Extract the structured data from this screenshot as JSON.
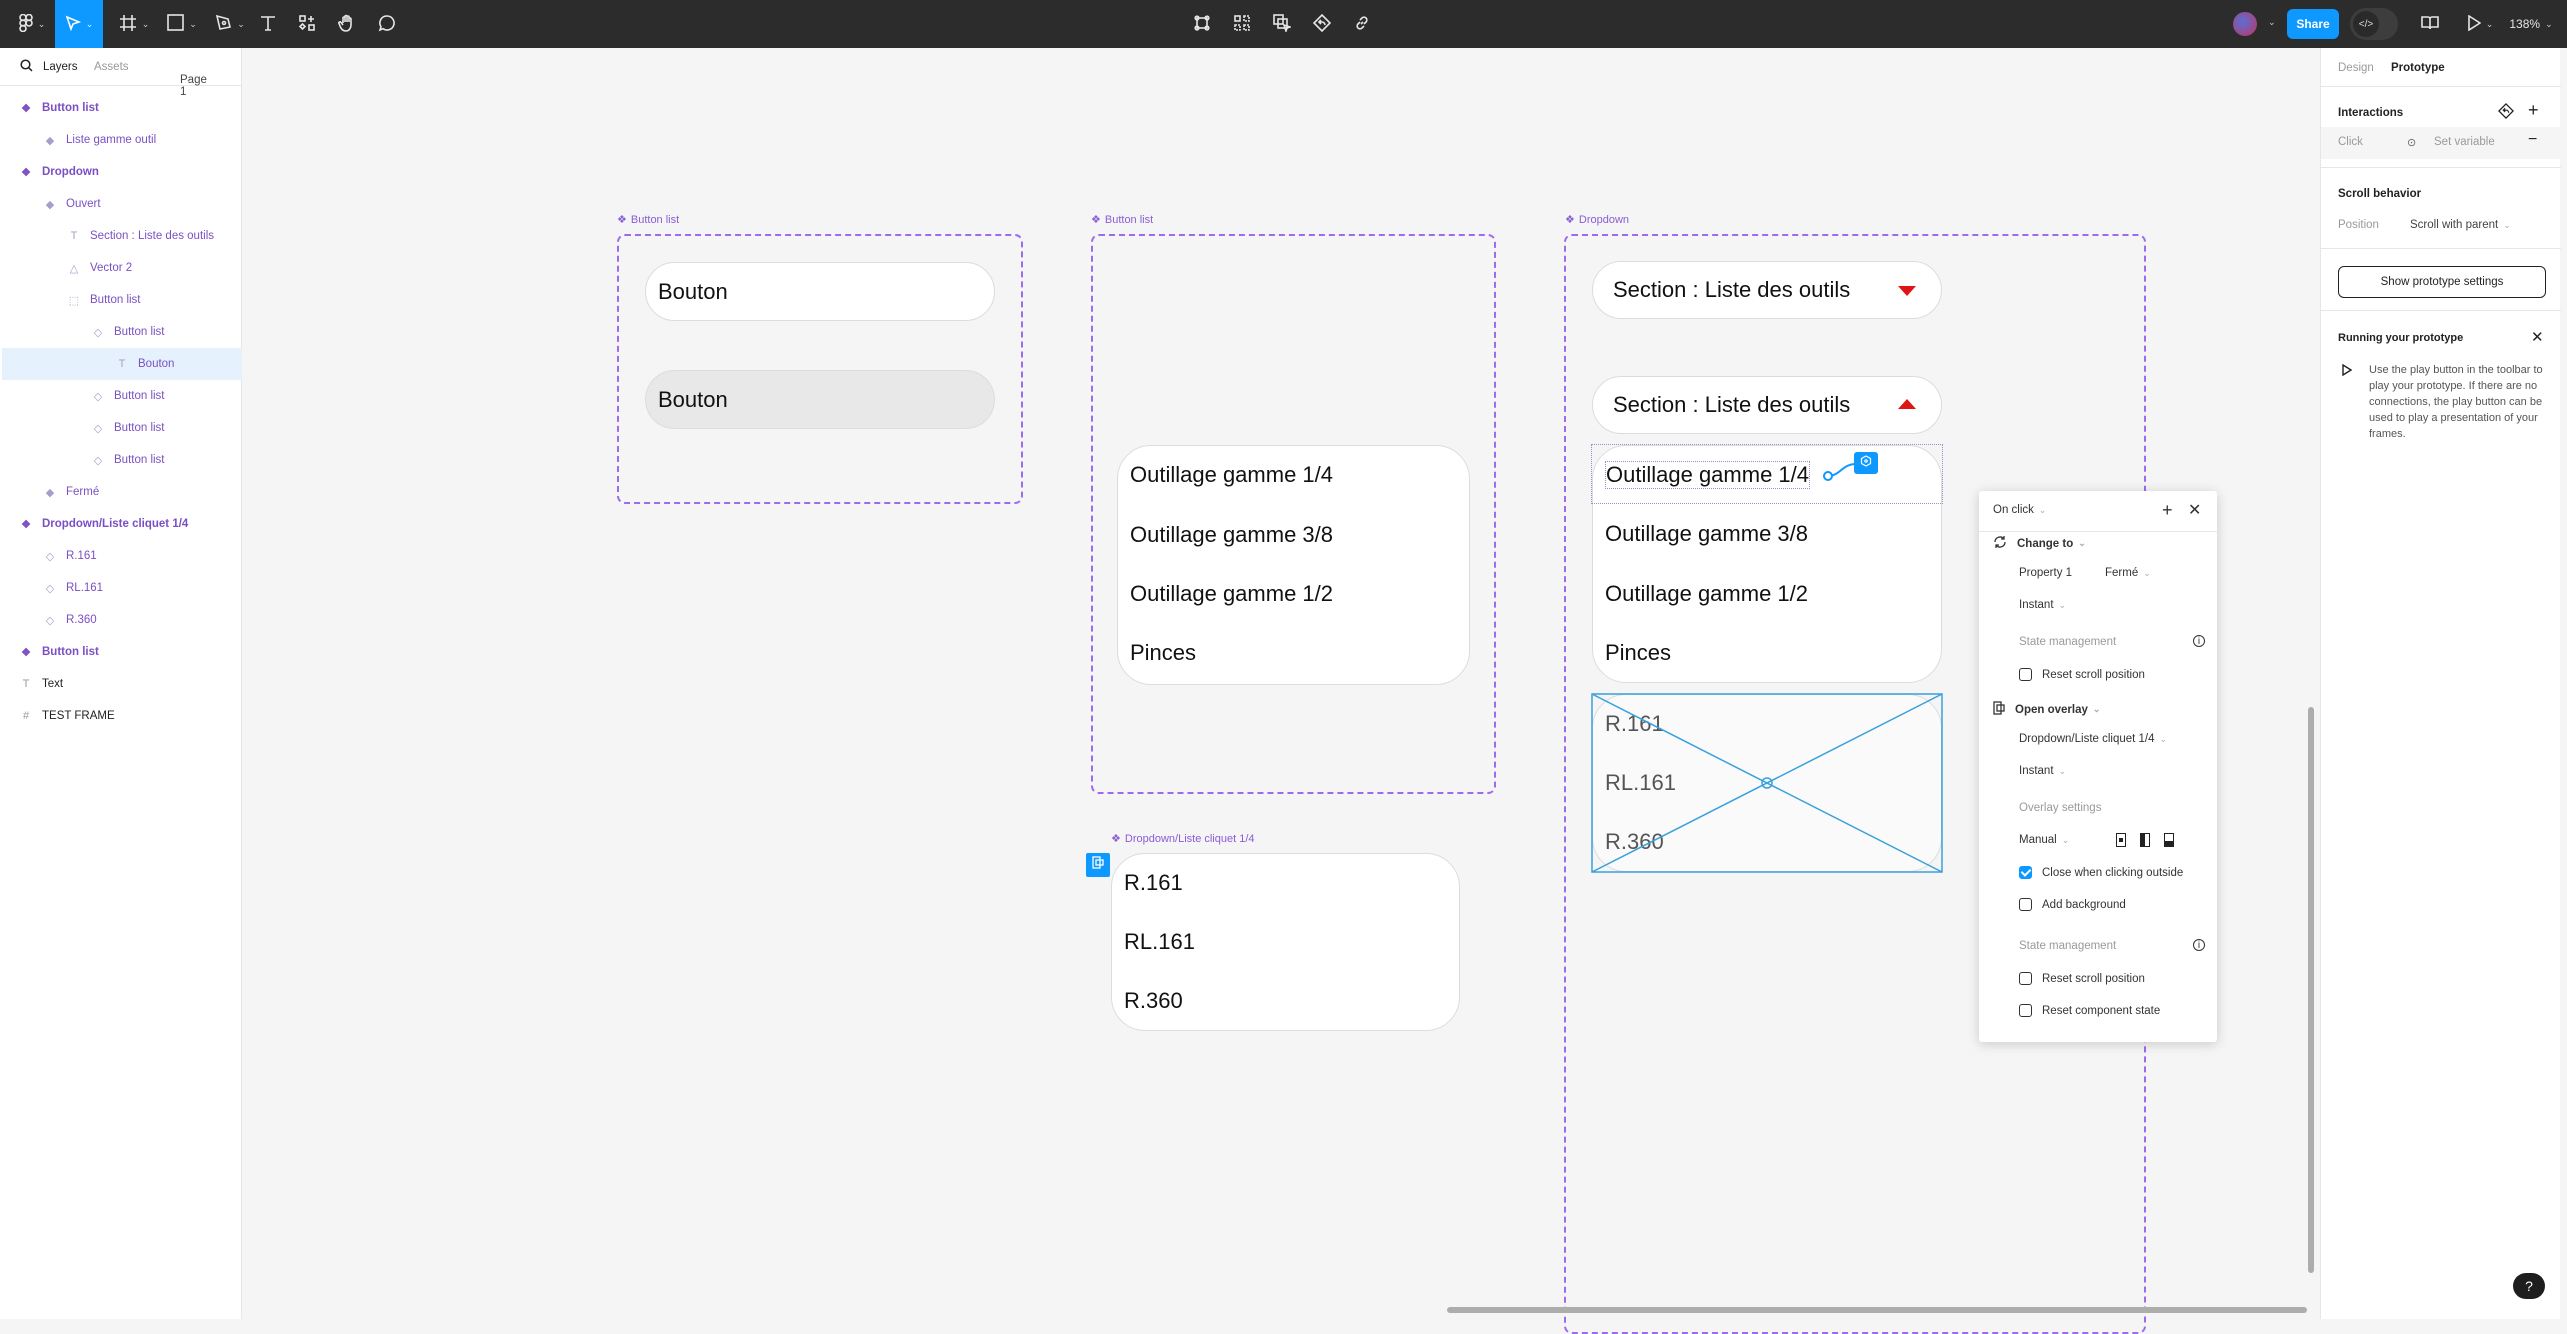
{
  "toolbar": {
    "tools": [
      {
        "name": "main-menu",
        "icon": "figma-logo-icon"
      },
      {
        "name": "move",
        "icon": "cursor-arrow-icon",
        "active": true
      },
      {
        "name": "frame",
        "icon": "frame-hash-icon"
      },
      {
        "name": "shape",
        "icon": "rectangle-icon"
      },
      {
        "name": "pen",
        "icon": "pen-icon"
      },
      {
        "name": "text",
        "icon": "text-icon"
      },
      {
        "name": "resources",
        "icon": "resources-icon"
      },
      {
        "name": "hand",
        "icon": "hand-icon"
      },
      {
        "name": "comment",
        "icon": "comment-icon"
      }
    ],
    "center_tools": [
      "component-edit-icon",
      "grid-icon",
      "overlay-select-icon",
      "reset-icon",
      "link-icon"
    ],
    "share_label": "Share",
    "dev_mode_icon": "</>",
    "zoom_label": "138%",
    "accent_color": "#0d99ff"
  },
  "left_panel": {
    "tabs": {
      "layers": "Layers",
      "assets": "Assets",
      "page": "Page 1"
    },
    "layers": [
      {
        "label": "Button list",
        "type": "component-set",
        "indent": 0
      },
      {
        "label": "Liste gamme outil",
        "type": "variant",
        "indent": 1
      },
      {
        "label": "Dropdown",
        "type": "component-set",
        "indent": 0
      },
      {
        "label": "Ouvert",
        "type": "variant",
        "indent": 1
      },
      {
        "label": "Section : Liste des outils",
        "type": "text",
        "indent": 2
      },
      {
        "label": "Vector 2",
        "type": "vector",
        "indent": 2
      },
      {
        "label": "Button list",
        "type": "instance-frame",
        "indent": 2
      },
      {
        "label": "Button list",
        "type": "instance",
        "indent": 3
      },
      {
        "label": "Bouton",
        "type": "text",
        "indent": 4,
        "selected": true
      },
      {
        "label": "Button list",
        "type": "instance",
        "indent": 3
      },
      {
        "label": "Button list",
        "type": "instance",
        "indent": 3
      },
      {
        "label": "Button list",
        "type": "instance",
        "indent": 3
      },
      {
        "label": "Fermé",
        "type": "variant",
        "indent": 1
      },
      {
        "label": "Dropdown/Liste cliquet 1/4",
        "type": "component-set",
        "indent": 0
      },
      {
        "label": "R.161",
        "type": "instance",
        "indent": 1
      },
      {
        "label": "RL.161",
        "type": "instance",
        "indent": 1
      },
      {
        "label": "R.360",
        "type": "instance",
        "indent": 1
      },
      {
        "label": "Button list",
        "type": "component-set",
        "indent": 0
      },
      {
        "label": "Text",
        "type": "text-plain",
        "indent": 0
      },
      {
        "label": "TEST FRAME",
        "type": "frame",
        "indent": 0
      }
    ]
  },
  "right_panel": {
    "tabs": {
      "design": "Design",
      "prototype": "Prototype"
    },
    "interactions_title": "Interactions",
    "interaction": {
      "trigger": "Click",
      "action": "Set variable"
    },
    "scroll_title": "Scroll behavior",
    "position_label": "Position",
    "position_value": "Scroll with parent",
    "show_settings_label": "Show prototype settings",
    "running_title": "Running your prototype",
    "running_text": "Use the play button in the toolbar to play your prototype. If there are no connections, the play button can be used to play a presentation of your frames."
  },
  "popover": {
    "trigger": "On click",
    "action1": {
      "label": "Change to",
      "property_label": "Property 1",
      "property_value": "Fermé",
      "animation": "Instant",
      "state_title": "State management",
      "reset_scroll": {
        "label": "Reset scroll position",
        "checked": false
      }
    },
    "action2": {
      "label": "Open overlay",
      "destination": "Dropdown/Liste cliquet 1/4",
      "animation": "Instant",
      "overlay_title": "Overlay settings",
      "position": "Manual",
      "close_outside": {
        "label": "Close when clicking outside",
        "checked": true
      },
      "add_background": {
        "label": "Add background",
        "checked": false
      },
      "state_title": "State management",
      "reset_scroll": {
        "label": "Reset scroll position",
        "checked": false
      },
      "reset_component": {
        "label": "Reset component state",
        "checked": false
      }
    }
  },
  "canvas": {
    "frame1": {
      "label": "Button list",
      "buttons": [
        "Bouton",
        "Bouton"
      ]
    },
    "frame2": {
      "label": "Button list",
      "items": [
        "Outillage gamme 1/4",
        "Outillage gamme 3/8",
        "Outillage gamme 1/2",
        "Pinces"
      ]
    },
    "frame3": {
      "label": "Dropdown",
      "closed_header": "Section : Liste des outils",
      "open_header": "Section : Liste des outils",
      "items": [
        "Outillage gamme 1/4",
        "Outillage gamme 3/8",
        "Outillage gamme 1/2",
        "Pinces"
      ],
      "overlay_items": [
        "R.161",
        "RL.161",
        "R.360"
      ]
    },
    "frame4": {
      "label": "Dropdown/Liste cliquet 1/4",
      "items": [
        "R.161",
        "RL.161",
        "R.360"
      ]
    },
    "component_color": "#9d6bf0",
    "arrow_color": "#e01414"
  },
  "help_label": "?"
}
